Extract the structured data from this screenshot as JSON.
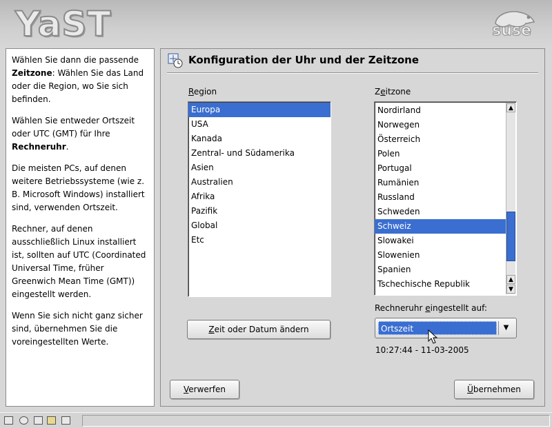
{
  "header": {
    "logo_left": "YaST",
    "logo_right": "suse"
  },
  "help": {
    "p1_pre": "Wählen Sie dann die passende ",
    "p1_bold": "Zeitzone",
    "p1_post": ": Wählen Sie das Land oder die Region, wo Sie sich befinden.",
    "p2_pre": "Wählen Sie entweder Ortszeit oder UTC (GMT) für Ihre ",
    "p2_bold": "Rechneruhr",
    "p2_post": ".",
    "p3": "Die meisten PCs, auf denen weitere Betriebssysteme (wie z. B. Microsoft Windows) installiert sind, verwenden Ortszeit.",
    "p4": "Rechner, auf denen ausschließlich Linux installiert ist, sollten auf UTC (Coordinated Universal Time, früher Greenwich Mean Time (GMT)) eingestellt werden.",
    "p5": "Wenn Sie sich nicht ganz sicher sind, übernehmen Sie die voreingestellten Werte."
  },
  "main": {
    "title": "Konfiguration der Uhr und der Zeitzone",
    "region_label_first": "R",
    "region_label_rest": "egion",
    "region_items": [
      "Europa",
      "USA",
      "Kanada",
      "Zentral- und Südamerika",
      "Asien",
      "Australien",
      "Afrika",
      "Pazifik",
      "Global",
      "Etc"
    ],
    "region_selected": "Europa",
    "zone_label_first": "Z",
    "zone_label_second": "e",
    "zone_label_rest": "itzone",
    "zone_items": [
      "Nordirland",
      "Norwegen",
      "Österreich",
      "Polen",
      "Portugal",
      "Rumänien",
      "Russland",
      "Schweden",
      "Schweiz",
      "Slowakei",
      "Slowenien",
      "Spanien",
      "Tschechische Republik"
    ],
    "zone_selected": "Schweiz",
    "clock_label_first": "Rechneruhr ",
    "clock_label_u": "e",
    "clock_label_rest": "ingestellt auf:",
    "clock_value": "Ortszeit",
    "datetime": "10:27:44 - 11-03-2005",
    "change_btn_first": "Z",
    "change_btn_rest": "eit oder Datum ändern",
    "discard_first": "V",
    "discard_rest": "erwerfen",
    "accept_first": "Ü",
    "accept_rest": "bernehmen"
  },
  "colors": {
    "selection": "#3a6ed0",
    "background": "#d7d7d7"
  }
}
